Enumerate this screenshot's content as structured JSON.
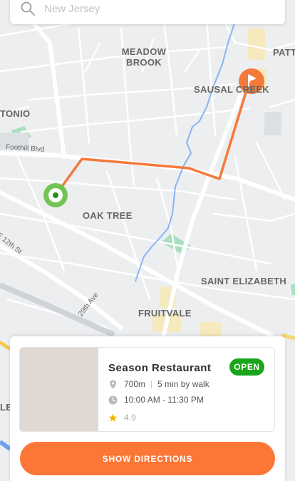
{
  "search": {
    "placeholder": "New Jersey"
  },
  "map": {
    "labels": {
      "meadow_brook": "MEADOW\nBROOK",
      "sausal_creek": "SAUSAL CREEK",
      "patt": "PATT",
      "tonio": "TONIO",
      "oak_tree": "OAK TREE",
      "saint_elizabeth": "SAINT ELIZABETH",
      "fruitvale": "FRUITVALE",
      "le": "LE"
    },
    "streets": {
      "foothill": "Foothill Blvd",
      "e12th": "E 12th St",
      "ave29": "29th Ave"
    },
    "colors": {
      "route": "#f5793b",
      "start": "#6cc24a",
      "destination": "#f5793b",
      "water": "#8ab4f8",
      "park": "#a9dfbf"
    }
  },
  "place": {
    "name": "Season Restaurant",
    "status": "OPEN",
    "distance": "700m",
    "walk_time": "5 min by walk",
    "hours": "10:00 AM - 11:30 PM",
    "rating": "4.9",
    "status_color": "#1aa51a"
  },
  "actions": {
    "directions_label": "SHOW DIRECTIONS",
    "button_color": "#fc7636"
  }
}
